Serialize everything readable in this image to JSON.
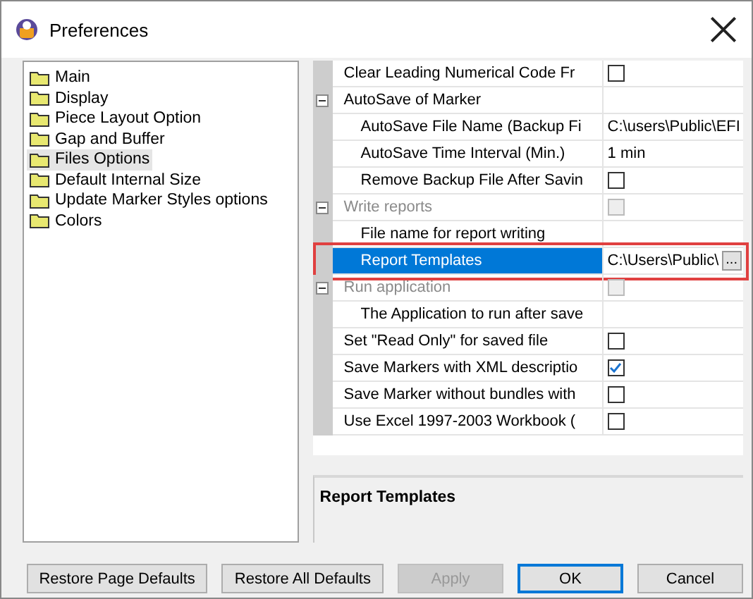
{
  "window": {
    "title": "Preferences"
  },
  "sidebar": {
    "items": [
      {
        "label": "Main",
        "selected": false
      },
      {
        "label": "Display",
        "selected": false
      },
      {
        "label": "Piece Layout Option",
        "selected": false
      },
      {
        "label": "Gap and Buffer",
        "selected": false
      },
      {
        "label": "Files Options",
        "selected": true
      },
      {
        "label": "Default Internal Size",
        "selected": false
      },
      {
        "label": "Update Marker Styles options",
        "selected": false
      },
      {
        "label": "Colors",
        "selected": false
      }
    ]
  },
  "properties": [
    {
      "name": "Clear Leading Numerical Code Fr",
      "kind": "checkbox",
      "checked": false,
      "disabled": false
    },
    {
      "name": "AutoSave of Marker",
      "kind": "category",
      "disabled": false,
      "expanded": true,
      "children": [
        {
          "name": "AutoSave File Name (Backup Fi",
          "kind": "text",
          "value": "C:\\users\\Public\\EFI"
        },
        {
          "name": "AutoSave Time Interval (Min.)",
          "kind": "text",
          "value": "1 min"
        },
        {
          "name": "Remove Backup File After Savin",
          "kind": "checkbox",
          "checked": false,
          "disabled": false
        }
      ]
    },
    {
      "name": "Write reports",
      "kind": "checkbox",
      "disabled": true,
      "checked": false,
      "expanded": true,
      "children": [
        {
          "name": "File name for report writing",
          "kind": "text"
        },
        {
          "name": "Report Templates",
          "kind": "path",
          "value": "C:\\Users\\Public\\",
          "button": "...",
          "selected": true,
          "highlighted": true
        }
      ]
    },
    {
      "name": "Run application",
      "kind": "checkbox",
      "disabled": true,
      "checked": false,
      "expanded": true,
      "children": [
        {
          "name": "The Application to run after save",
          "kind": "text"
        }
      ]
    },
    {
      "name": "Set \"Read Only\" for saved file",
      "kind": "checkbox",
      "checked": false,
      "disabled": false
    },
    {
      "name": "Save Markers with XML descriptio",
      "kind": "checkbox",
      "checked": true,
      "disabled": false
    },
    {
      "name": "Save Marker without bundles with",
      "kind": "checkbox",
      "checked": false,
      "disabled": false
    },
    {
      "name": "Use Excel 1997-2003 Workbook (",
      "kind": "checkbox",
      "checked": false,
      "disabled": false
    }
  ],
  "description": {
    "title": "Report Templates"
  },
  "buttons": [
    {
      "label": "Restore Page Defaults",
      "kind": "normal"
    },
    {
      "label": "Restore All Defaults",
      "kind": "normal"
    },
    {
      "label": "Apply",
      "kind": "disabled"
    },
    {
      "label": "OK",
      "kind": "default"
    },
    {
      "label": "Cancel",
      "kind": "normal"
    }
  ]
}
